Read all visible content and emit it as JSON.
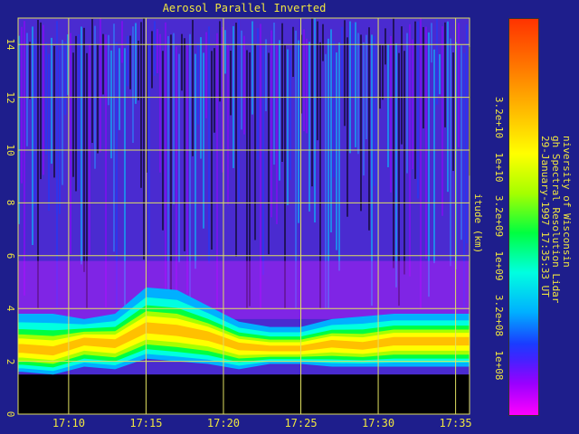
{
  "chart_data": {
    "type": "heatmap",
    "title": "Aerosol Parallel Inverted",
    "ylabel": "itude (km)",
    "ylim": [
      0,
      15
    ],
    "yticks": [
      "0",
      "2",
      "4",
      "6",
      "8",
      "10",
      "12",
      "14"
    ],
    "xlim": [
      "17:06:44",
      "17:35:54"
    ],
    "xticks": [
      "17:10",
      "17:15",
      "17:20",
      "17:25",
      "17:30",
      "17:35"
    ],
    "grid": true,
    "colorbar": {
      "scale": "log",
      "range": [
        32000000.0,
        320000000000.0
      ],
      "ticks": [
        "1e+08",
        "3.2e+08",
        "1e+09",
        "3.2e+09",
        "1e+10",
        "3.2e+10"
      ],
      "colors": [
        "#ff00ff",
        "#9900ff",
        "#4422ff",
        "#1a3cff",
        "#00b0ff",
        "#00ffe0",
        "#00ff40",
        "#a6ff00",
        "#ffff00",
        "#ffc000",
        "#ff7700",
        "#ff3300"
      ]
    },
    "aerosol_layer": {
      "time": [
        "17:07",
        "17:09",
        "17:11",
        "17:13",
        "17:15",
        "17:17",
        "17:19",
        "17:21",
        "17:23",
        "17:25",
        "17:27",
        "17:29",
        "17:31",
        "17:33",
        "17:35"
      ],
      "base_km": [
        1.6,
        1.5,
        1.8,
        1.7,
        2.1,
        2.0,
        1.9,
        1.7,
        1.9,
        1.9,
        1.8,
        1.8,
        1.8,
        1.8,
        1.8
      ],
      "peak_km": [
        2.5,
        2.4,
        2.8,
        2.7,
        3.3,
        3.2,
        3.0,
        2.6,
        2.5,
        2.5,
        2.7,
        2.6,
        2.8,
        2.8,
        2.8
      ],
      "top_km": [
        3.8,
        3.8,
        3.6,
        3.8,
        4.8,
        4.7,
        4.1,
        3.5,
        3.3,
        3.3,
        3.6,
        3.7,
        3.8,
        3.8,
        3.8
      ]
    },
    "caption_lines": [
      "niversity of Wisconsin",
      "gh Spectral Resolution Lidar",
      "29-January-1997  17:35:33 UT"
    ]
  },
  "colors": {
    "background": "#1e1e8c",
    "text": "#f0e640",
    "grid": "#e0e060",
    "no_data": "#000000"
  }
}
